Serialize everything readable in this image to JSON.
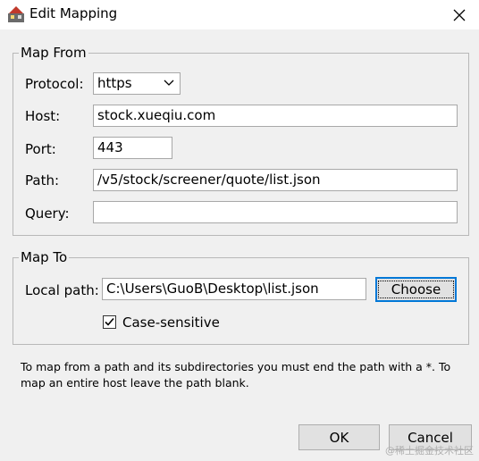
{
  "window": {
    "title": "Edit Mapping"
  },
  "map_from": {
    "legend": "Map From",
    "protocol_label": "Protocol:",
    "protocol_value": "https",
    "host_label": "Host:",
    "host_value": "stock.xueqiu.com",
    "port_label": "Port:",
    "port_value": "443",
    "path_label": "Path:",
    "path_value": "/v5/stock/screener/quote/list.json",
    "query_label": "Query:",
    "query_value": ""
  },
  "map_to": {
    "legend": "Map To",
    "local_path_label": "Local path:",
    "local_path_value": "C:\\Users\\GuoB\\Desktop\\list.json",
    "choose_label": "Choose",
    "case_sensitive_label": "Case-sensitive",
    "case_sensitive_checked": true
  },
  "hint": "To map from a path and its subdirectories you must end the path with a *. To map an entire host leave the path blank.",
  "footer": {
    "ok_label": "OK",
    "cancel_label": "Cancel"
  },
  "watermark": "@稀土掘金技术社区"
}
